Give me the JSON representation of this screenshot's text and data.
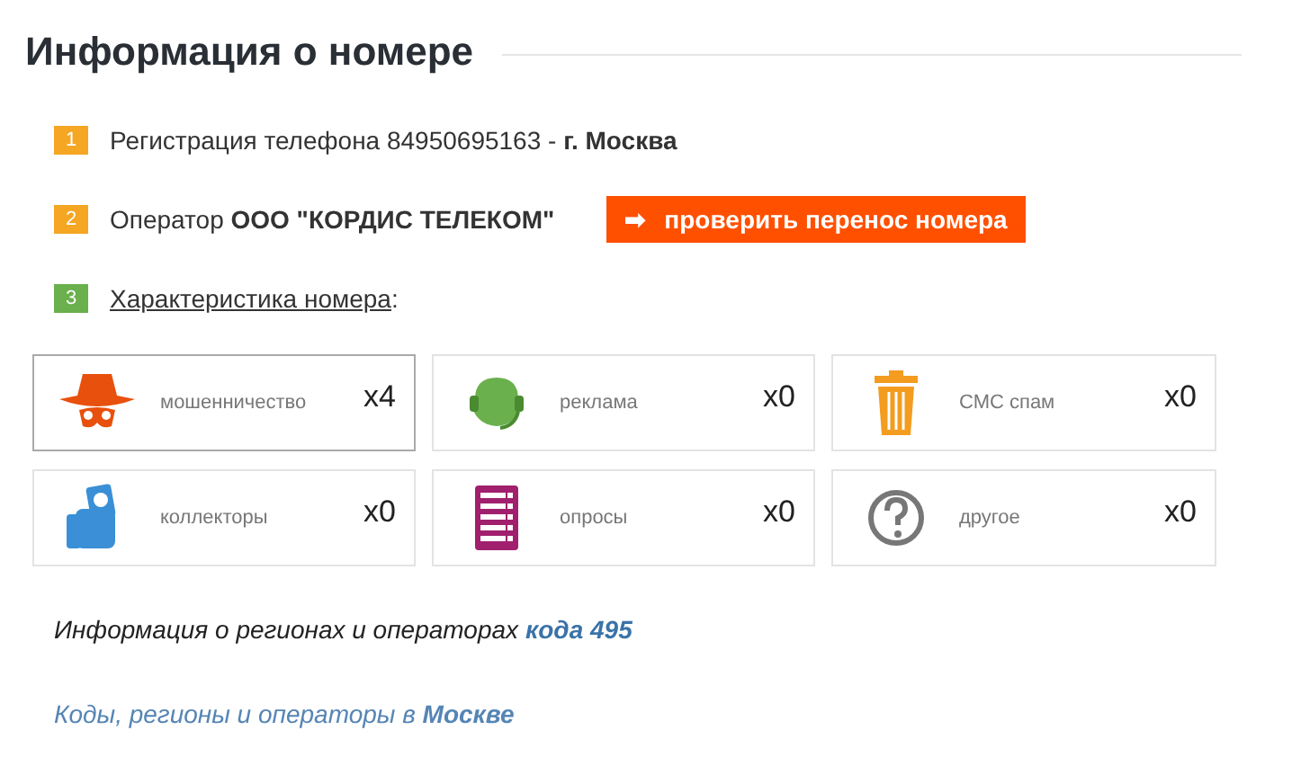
{
  "title": "Информация о номере",
  "steps": [
    {
      "number": "1",
      "color": "#f5a623",
      "kind": "text",
      "text": "Регистрация телефона 84950695163 - **г. Москва**"
    },
    {
      "number": "2",
      "color": "#f5a623",
      "kind": "text",
      "text": "Оператор **ООО \"КОРДИС ТЕЛЕКОМ\"**",
      "button": {
        "icon": "➡",
        "label": "проверить перенос номера"
      }
    },
    {
      "number": "3",
      "color": "#6ab04c",
      "kind": "link",
      "link": "Характеристика номера",
      "suffix": ":"
    }
  ],
  "categories": [
    {
      "kind": "fraud",
      "label": "мошенничество",
      "count": "x4",
      "selected": true
    },
    {
      "kind": "ads",
      "label": "реклама",
      "count": "x0",
      "selected": false
    },
    {
      "kind": "spam",
      "label": "СМС спам",
      "count": "x0",
      "selected": false
    },
    {
      "kind": "collectors",
      "label": "коллекторы",
      "count": "x0",
      "selected": false
    },
    {
      "kind": "polls",
      "label": "опросы",
      "count": "x0",
      "selected": false
    },
    {
      "kind": "other",
      "label": "другое",
      "count": "x0",
      "selected": false
    }
  ],
  "region_info": {
    "text": "Информация о регионах и операторах",
    "link": "кода 495"
  },
  "city_link": "Коды, регионы и операторы в **Москве**"
}
